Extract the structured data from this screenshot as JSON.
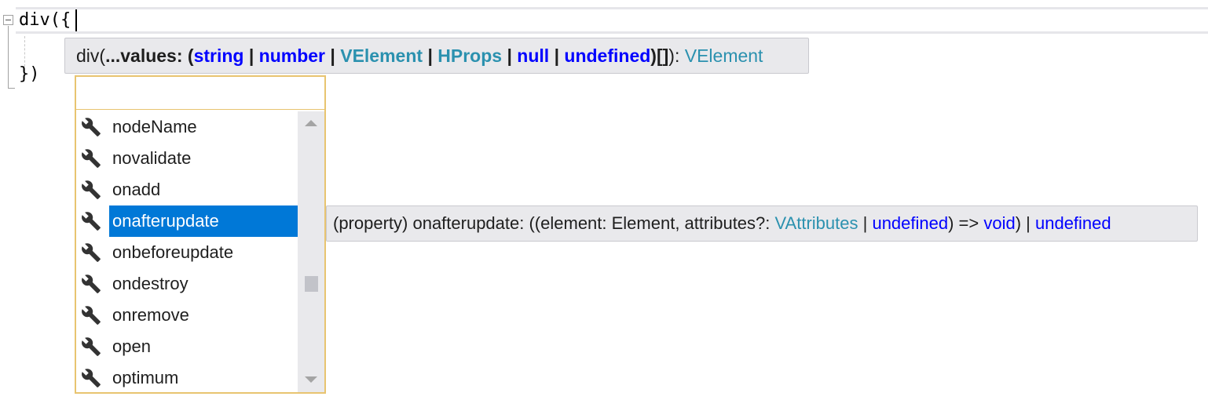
{
  "editor": {
    "line1": "div({",
    "line3": "})"
  },
  "signature_help": {
    "fn": "div(",
    "param": "...values: ",
    "open_paren": "(",
    "t1": "string",
    "t2": "number",
    "t3": "VElement",
    "t4": "HProps",
    "t5": "null",
    "t6": "undefined",
    "close": ")[]",
    "after": "): ",
    "ret": "VElement",
    "sep": " | "
  },
  "completion": {
    "filter_value": "",
    "items": [
      {
        "label": "nodeName",
        "icon": "wrench-icon"
      },
      {
        "label": "novalidate",
        "icon": "wrench-icon"
      },
      {
        "label": "onadd",
        "icon": "wrench-icon"
      },
      {
        "label": "onafterupdate",
        "icon": "wrench-icon"
      },
      {
        "label": "onbeforeupdate",
        "icon": "wrench-icon"
      },
      {
        "label": "ondestroy",
        "icon": "wrench-icon"
      },
      {
        "label": "onremove",
        "icon": "wrench-icon"
      },
      {
        "label": "open",
        "icon": "wrench-icon"
      },
      {
        "label": "optimum",
        "icon": "wrench-icon"
      }
    ],
    "selected_index": 3
  },
  "quick_info": {
    "prefix": "(property) onafterupdate: ((element: Element, attributes?: ",
    "type1": "VAttributes",
    "sep1": " | ",
    "type2": "undefined",
    "mid": ") => ",
    "type3": "void",
    "sep2": ") | ",
    "type4": "undefined"
  },
  "colors": {
    "keyword": "#0000ff",
    "type": "#2b91af",
    "selection": "#0078d7",
    "list_border": "#e8c470"
  }
}
